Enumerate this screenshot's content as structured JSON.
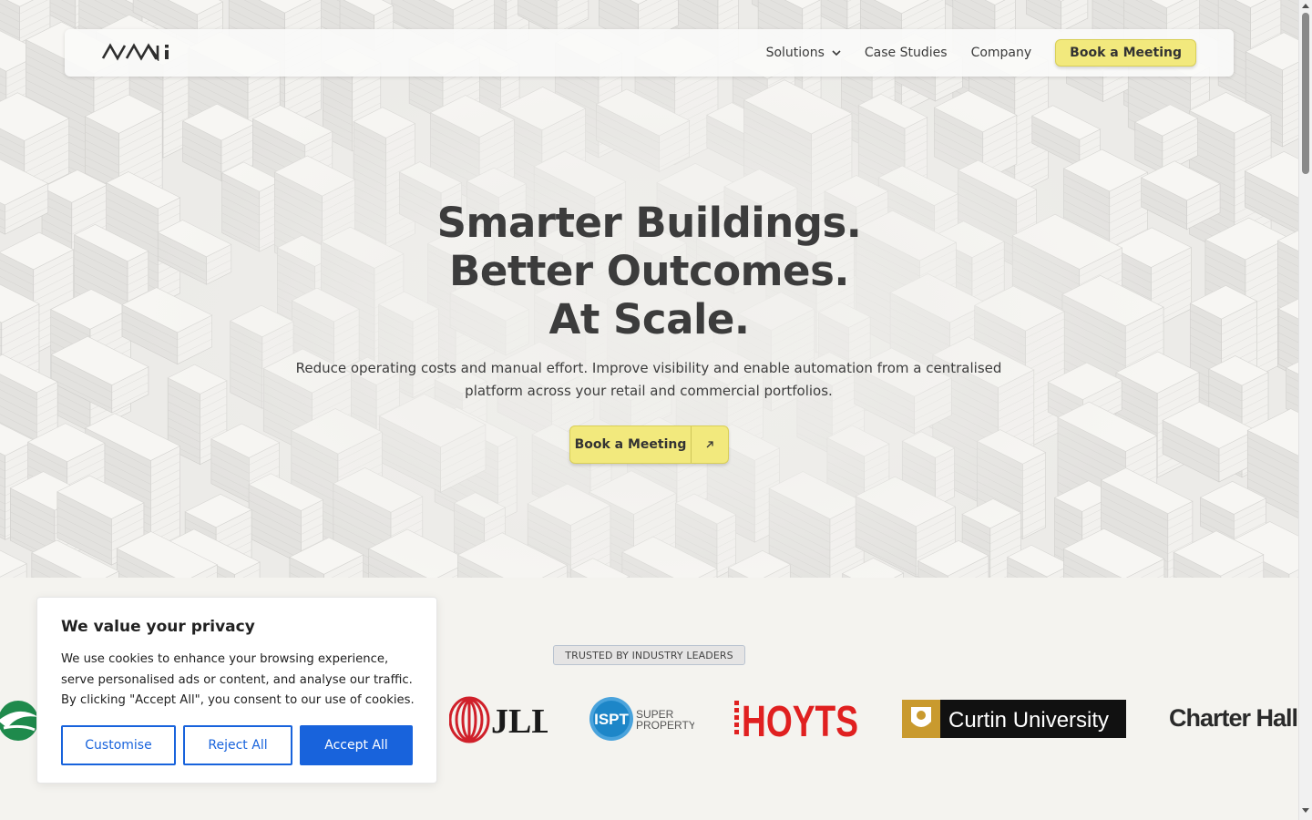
{
  "nav": {
    "logo_text": "AVANI",
    "links": [
      {
        "label": "Solutions"
      },
      {
        "label": "Case Studies"
      },
      {
        "label": "Company"
      }
    ],
    "cta_label": "Book a Meeting"
  },
  "hero": {
    "headline_lines": [
      "Smarter Buildings.",
      "Better Outcomes.",
      "At Scale."
    ],
    "subtitle": "Reduce operating costs and manual effort. Improve visibility and enable automation from a centralised platform across your retail and commercial portfolios.",
    "cta_label": "Book a Meeting",
    "cta_icon": "arrow-up-right-icon"
  },
  "trusted": {
    "badge": "TRUSTED BY INDUSTRY LEADERS",
    "logos": [
      "JLL",
      "ISPT",
      "SUPER",
      "PROPERTY",
      "HOYTS",
      "Curtin University",
      "Charter Hall"
    ]
  },
  "cookie": {
    "title": "We value your privacy",
    "body": "We use cookies to enhance your browsing experience, serve personalised ads or content, and analyse our traffic. By clicking \"Accept All\", you consent to our use of cookies.",
    "customise": "Customise",
    "reject": "Reject All",
    "accept": "Accept All"
  },
  "colors": {
    "accent_yellow": "#f2e97d",
    "cookie_blue": "#1863dc",
    "page_bg": "#f4f3ef"
  }
}
